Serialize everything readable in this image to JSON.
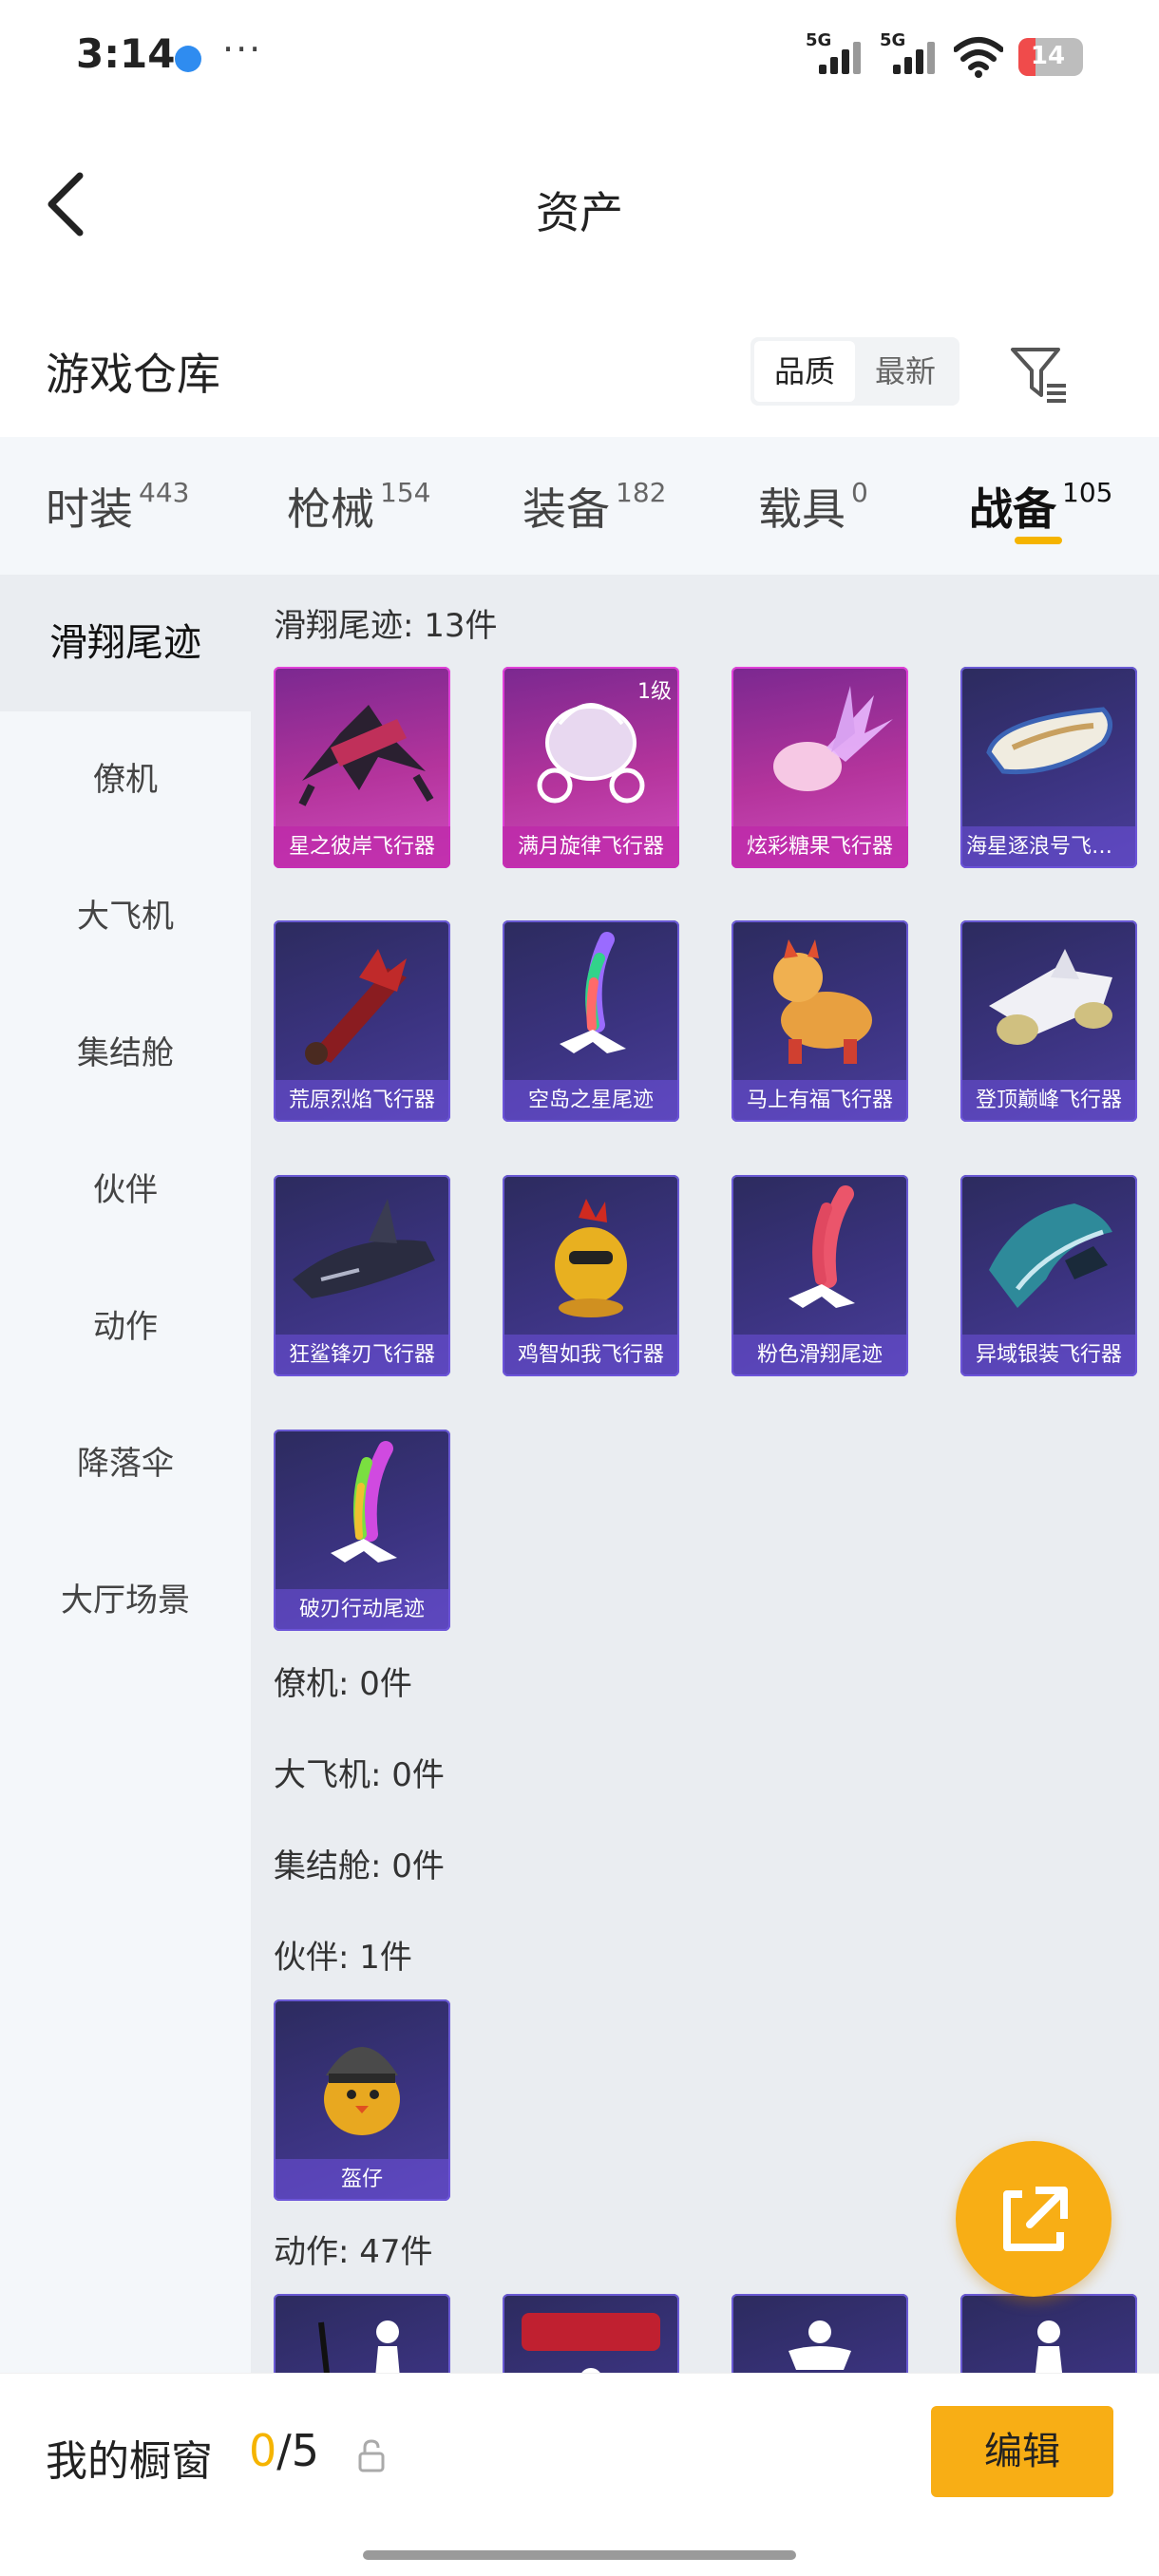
{
  "status_bar": {
    "time": "3:14",
    "more": "···",
    "signal1_label": "5G",
    "signal2_label": "5G",
    "battery": "14"
  },
  "header": {
    "title": "资产"
  },
  "section": {
    "title": "游戏仓库",
    "sort_options": [
      "品质",
      "最新"
    ],
    "sort_selected": "品质"
  },
  "tabs": [
    {
      "label": "时装",
      "count": "443"
    },
    {
      "label": "枪械",
      "count": "154"
    },
    {
      "label": "装备",
      "count": "182"
    },
    {
      "label": "载具",
      "count": "0"
    },
    {
      "label": "战备",
      "count": "105",
      "active": true
    }
  ],
  "side_menu": [
    {
      "label": "滑翔尾迹",
      "active": true
    },
    {
      "label": "僚机"
    },
    {
      "label": "大飞机"
    },
    {
      "label": "集结舱"
    },
    {
      "label": "伙伴"
    },
    {
      "label": "动作"
    },
    {
      "label": "降落伞"
    },
    {
      "label": "大厅场景"
    }
  ],
  "groups": [
    {
      "title": "滑翔尾迹: 13件"
    },
    {
      "title": "僚机: 0件"
    },
    {
      "title": "大飞机: 0件"
    },
    {
      "title": "集结舱: 0件"
    },
    {
      "title": "伙伴: 1件"
    },
    {
      "title": "动作: 47件"
    }
  ],
  "items": [
    {
      "name": "星之彼岸飞行器",
      "rarity": "pink",
      "icon": "dark-wing-glider-icon"
    },
    {
      "name": "满月旋律飞行器",
      "rarity": "pink",
      "icon": "carriage-glider-icon",
      "badge": "1级"
    },
    {
      "name": "炫彩糖果飞行器",
      "rarity": "pink",
      "icon": "candy-glider-icon"
    },
    {
      "name": "海星逐浪号飞行器",
      "rarity": "purple",
      "icon": "boat-glider-icon"
    },
    {
      "name": "荒原烈焰飞行器",
      "rarity": "purple",
      "icon": "flame-glider-icon"
    },
    {
      "name": "空岛之星尾迹",
      "rarity": "purple",
      "icon": "rainbow-trail-icon"
    },
    {
      "name": "马上有福飞行器",
      "rarity": "purple",
      "icon": "horse-glider-icon"
    },
    {
      "name": "登顶巅峰飞行器",
      "rarity": "purple",
      "icon": "jet-glider-icon"
    },
    {
      "name": "狂鲨锋刃飞行器",
      "rarity": "purple",
      "icon": "shark-glider-icon"
    },
    {
      "name": "鸡智如我飞行器",
      "rarity": "purple",
      "icon": "chicken-glider-icon"
    },
    {
      "name": "粉色滑翔尾迹",
      "rarity": "purple",
      "icon": "pink-trail-icon"
    },
    {
      "name": "异域银装飞行器",
      "rarity": "purple",
      "icon": "silver-wing-glider-icon"
    },
    {
      "name": "破刃行动尾迹",
      "rarity": "purple",
      "icon": "gradient-trail-icon"
    }
  ],
  "companion_items": [
    {
      "name": "盔仔",
      "rarity": "purple",
      "icon": "helmet-chick-icon"
    }
  ],
  "bottom_bar": {
    "label": "我的橱窗",
    "current": "0",
    "total": "/5",
    "edit_label": "编辑"
  },
  "colors": {
    "accent": "#f8ae15",
    "tab_underline": "#f5b400",
    "card_purple": "#3b3380",
    "card_pink": "#b4349c"
  }
}
